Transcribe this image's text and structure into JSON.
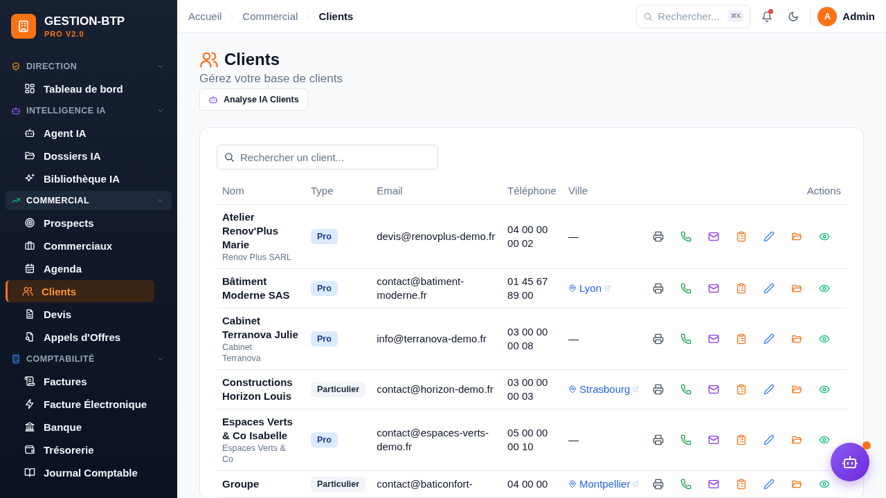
{
  "brand": {
    "name": "GESTION-BTP",
    "version": "PRO V2.0"
  },
  "sidebar": {
    "sections": [
      {
        "label": "DIRECTION",
        "selected": false,
        "items": [
          {
            "label": "Tableau de bord",
            "selected": false
          }
        ]
      },
      {
        "label": "INTELLIGENCE IA",
        "selected": false,
        "items": [
          {
            "label": "Agent IA",
            "selected": false
          },
          {
            "label": "Dossiers IA",
            "selected": false
          },
          {
            "label": "Bibliothèque IA",
            "selected": false
          }
        ]
      },
      {
        "label": "COMMERCIAL",
        "selected": true,
        "items": [
          {
            "label": "Prospects",
            "selected": false
          },
          {
            "label": "Commerciaux",
            "selected": false
          },
          {
            "label": "Agenda",
            "selected": false
          },
          {
            "label": "Clients",
            "selected": true
          },
          {
            "label": "Devis",
            "selected": false
          },
          {
            "label": "Appels d'Offres",
            "selected": false
          }
        ]
      },
      {
        "label": "COMPTABILITÉ",
        "selected": false,
        "items": [
          {
            "label": "Factures",
            "selected": false
          },
          {
            "label": "Facture Électronique",
            "selected": false
          },
          {
            "label": "Banque",
            "selected": false
          },
          {
            "label": "Trésorerie",
            "selected": false
          },
          {
            "label": "Journal Comptable",
            "selected": false
          }
        ]
      }
    ]
  },
  "breadcrumb": [
    "Accueil",
    "Commercial",
    "Clients"
  ],
  "topbar": {
    "search": {
      "placeholder": "Rechercher...",
      "shortcut": "⌘K"
    },
    "notifications": true,
    "user": {
      "initial": "A",
      "name": "Admin"
    }
  },
  "page": {
    "title": "Clients",
    "subtitle": "Gérez votre base de clients",
    "ai_button": "Analyse IA Clients"
  },
  "table": {
    "search": {
      "placeholder": "Rechercher un client..."
    },
    "columns": [
      "Nom",
      "Type",
      "Email",
      "Téléphone",
      "Ville",
      "Actions"
    ],
    "rows": [
      {
        "name": "Atelier Renov'Plus Marie",
        "company": "Renov Plus SARL",
        "type": "Pro",
        "professional": true,
        "email": "devis@renovplus-demo.fr",
        "phone": "04 00 00 00 02",
        "city": "—",
        "city_link": false
      },
      {
        "name": "Bâtiment Moderne SAS",
        "type": "Pro",
        "professional": true,
        "email": "contact@batiment-moderne.fr",
        "phone": "01 45 67 89 00",
        "city": "Lyon",
        "city_link": true
      },
      {
        "name": "Cabinet Terranova Julie",
        "company": "Cabinet Terranova",
        "type": "Pro",
        "professional": true,
        "email": "info@terranova-demo.fr",
        "phone": "03 00 00 00 08",
        "city": "—",
        "city_link": false
      },
      {
        "name": "Constructions Horizon Louis",
        "type": "Particulier",
        "professional": false,
        "email": "contact@horizon-demo.fr",
        "phone": "03 00 00 00 03",
        "city": "Strasbourg",
        "city_link": true
      },
      {
        "name": "Espaces Verts & Co Isabelle",
        "company": "Espaces Verts & Co",
        "type": "Pro",
        "professional": true,
        "email": "contact@espaces-verts-demo.fr",
        "phone": "05 00 00 00 10",
        "city": "—",
        "city_link": false
      },
      {
        "name": "Groupe",
        "type": "Particulier",
        "professional": false,
        "email": "contact@baticonfort-",
        "phone": "04 00 00",
        "city": "Montpellier",
        "city_link": true
      }
    ]
  },
  "assistant": {
    "badge": true
  }
}
